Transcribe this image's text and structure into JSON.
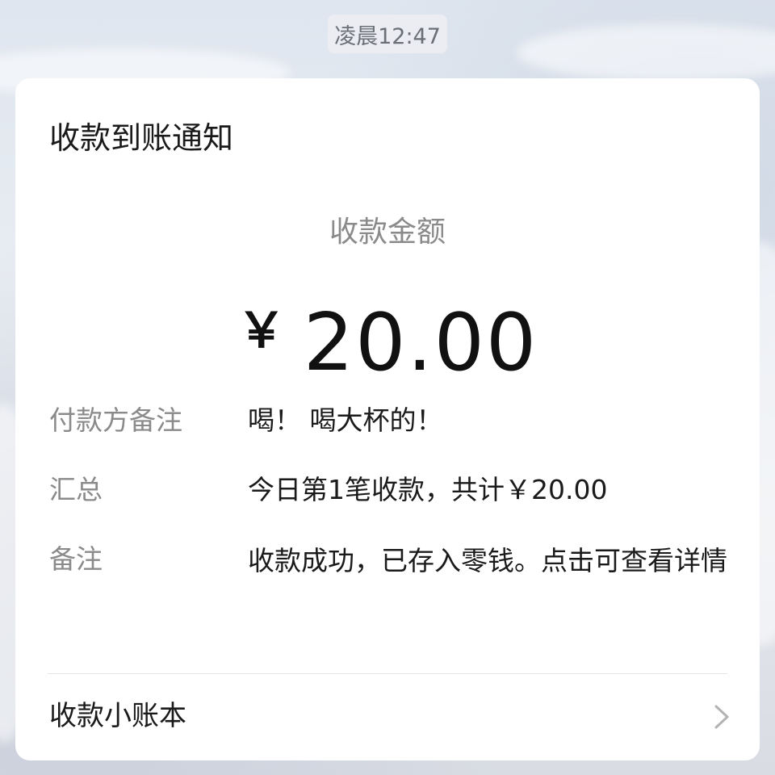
{
  "timestamp": "凌晨12:47",
  "notification": {
    "title": "收款到账通知",
    "amount_label": "收款金额",
    "currency_symbol": "￥",
    "amount": "20.00",
    "rows": [
      {
        "label": "付款方备注",
        "value": "喝！ 喝大杯的！"
      },
      {
        "label": "汇总",
        "value": "今日第1笔收款，共计￥20.00"
      },
      {
        "label": "备注",
        "value": "收款成功，已存入零钱。点击可查看详情"
      }
    ],
    "footer_label": "收款小账本",
    "footer_icon": "chevron-right-icon"
  },
  "colors": {
    "card_background": "#ffffff",
    "primary_text": "#1a1a1a",
    "secondary_text": "#8a8a8a"
  }
}
